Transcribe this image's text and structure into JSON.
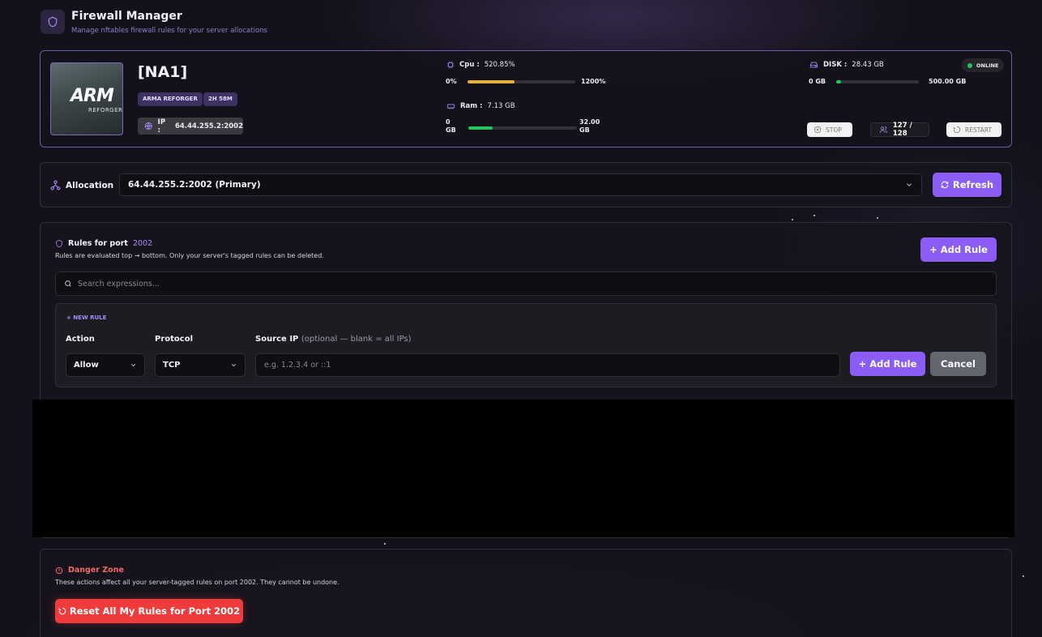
{
  "header": {
    "title": "Firewall Manager",
    "subtitle": "Manage nftables firewall rules for your server allocations",
    "icon": "shield-icon"
  },
  "server": {
    "name": "[NA1]",
    "thumbnail_logo": "ARM",
    "thumbnail_logo_sub": "REFORGER",
    "tags": [
      "ARMA REFORGER",
      "2H 58M"
    ],
    "ip_label": "IP :",
    "ip_value": "64.44.255.2:2002",
    "status": "ONLINE",
    "cpu": {
      "label": "Cpu :",
      "value": "520.85%",
      "min": "0%",
      "max": "1200%",
      "fraction": 0.434,
      "color": "#e8b22a"
    },
    "ram": {
      "label": "Ram :",
      "value": "7.13 GB",
      "min_line1": "0",
      "min_line2": "GB",
      "max_line1": "32.00",
      "max_line2": "GB",
      "fraction": 0.223,
      "color": "#22c55e"
    },
    "disk": {
      "label": "DISK :",
      "value": "28.43 GB",
      "min": "0 GB",
      "max": "500.00 GB",
      "fraction": 0.057,
      "color": "#22c55e"
    },
    "stop_label": "STOP",
    "players": "127 / 128",
    "restart_label": "RESTART"
  },
  "allocation": {
    "label": "Allocation",
    "selected": "64.44.255.2:2002 (Primary)",
    "refresh_label": "Refresh"
  },
  "rules": {
    "title": "Rules for port",
    "port": "2002",
    "subtitle": "Rules are evaluated top → bottom. Only your server's tagged rules can be deleted.",
    "add_rule_label": "+ Add Rule",
    "search_placeholder": "Search expressions...",
    "new_rule": {
      "heading": "+ NEW RULE",
      "action_label": "Action",
      "action_value": "Allow",
      "protocol_label": "Protocol",
      "protocol_value": "TCP",
      "source_label": "Source IP",
      "source_hint": "(optional — blank = all IPs)",
      "source_placeholder": "e.g. 1.2.3.4 or ::1",
      "add_label": "+ Add Rule",
      "cancel_label": "Cancel"
    }
  },
  "danger": {
    "title": "Danger Zone",
    "subtitle": "These actions affect all your server-tagged rules on port 2002. They cannot be undone.",
    "reset_label": "Reset All My Rules for Port 2002"
  }
}
